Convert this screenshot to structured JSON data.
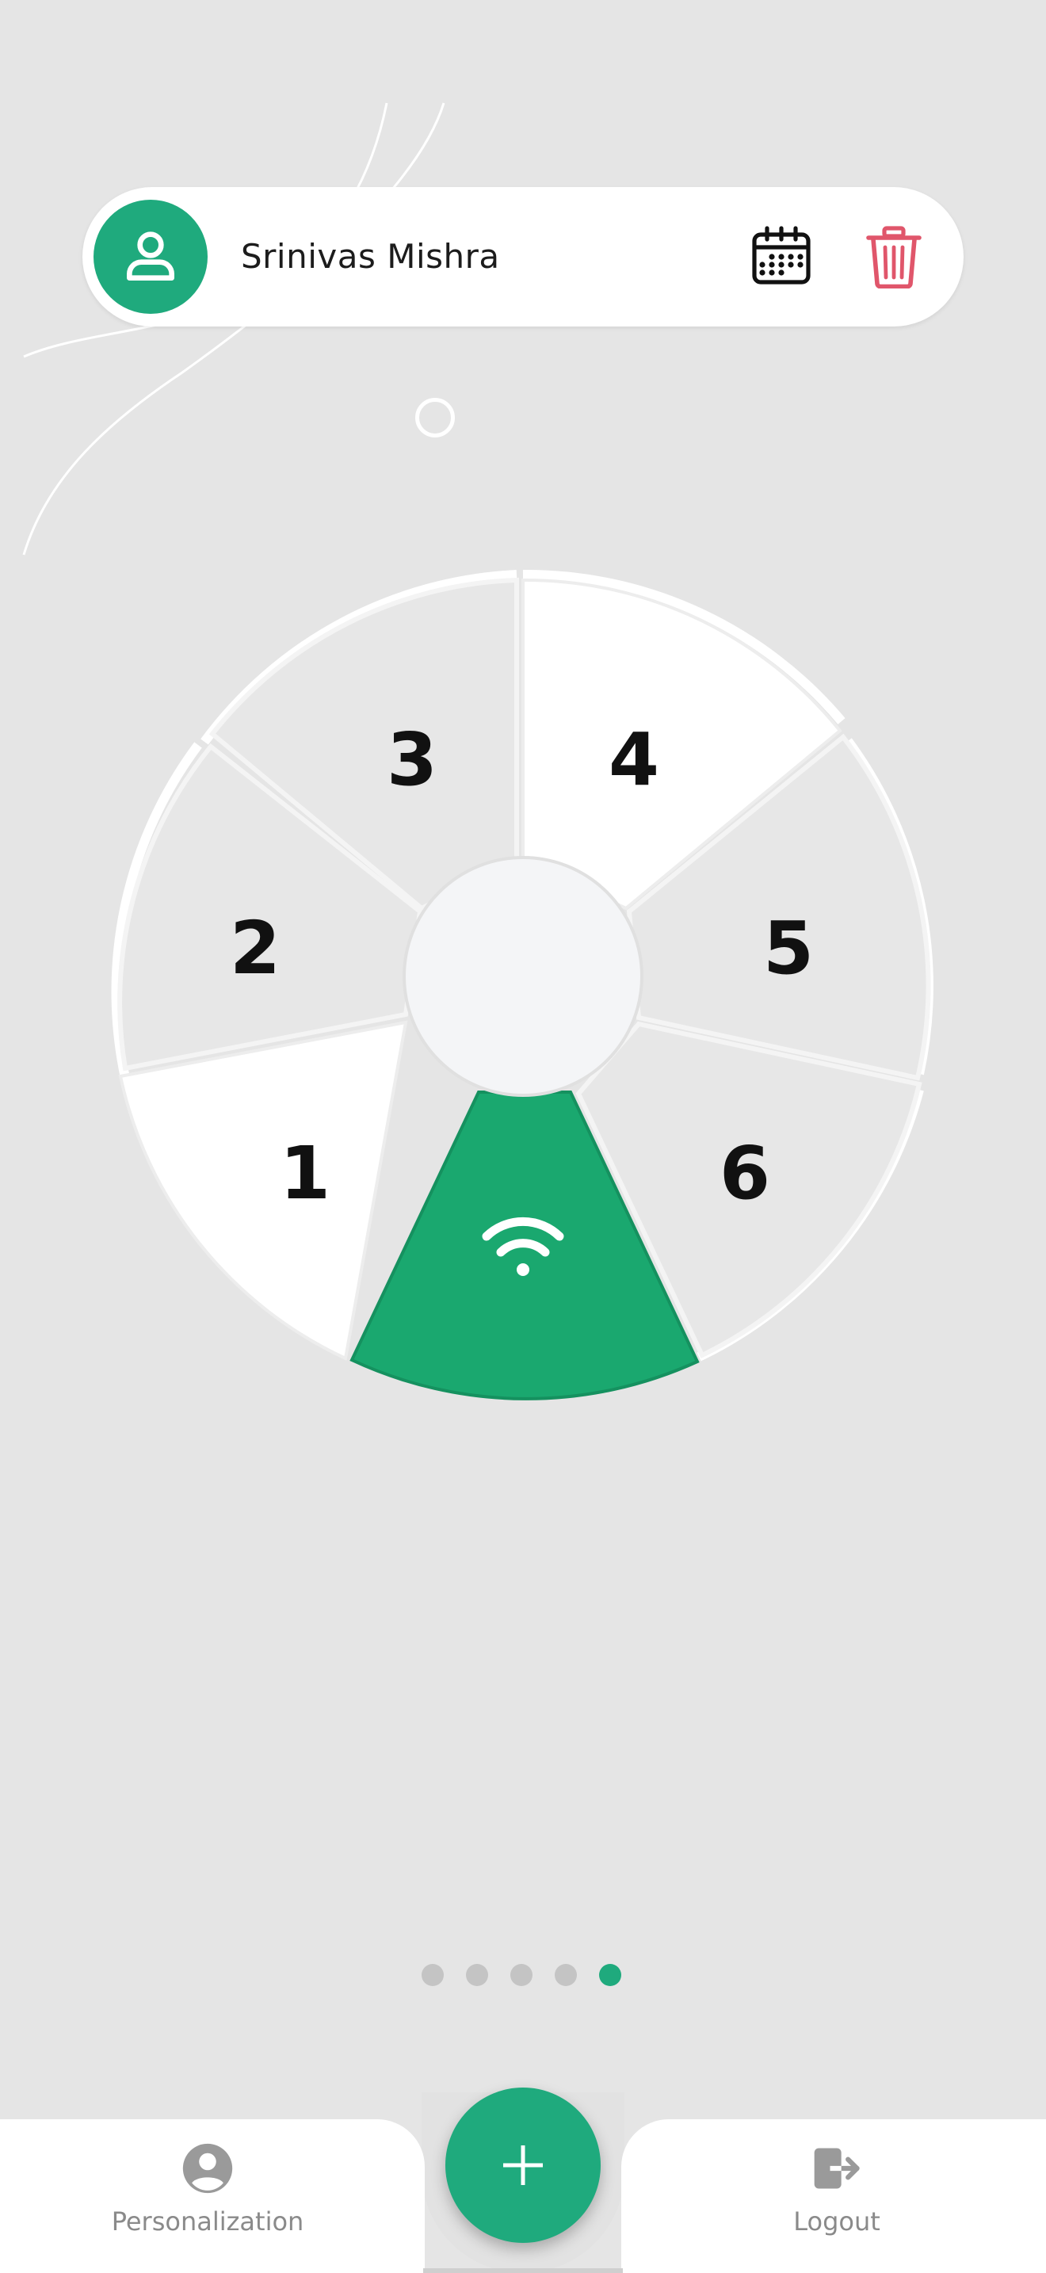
{
  "user": {
    "name": "Srinivas Mishra",
    "avatar_icon": "person-icon"
  },
  "header_actions": {
    "calendar_icon": "calendar-icon",
    "delete_icon": "trash-icon"
  },
  "wheel": {
    "segments": [
      {
        "label": "1"
      },
      {
        "label": "2"
      },
      {
        "label": "3"
      },
      {
        "label": "4"
      },
      {
        "label": "5"
      },
      {
        "label": "6"
      }
    ],
    "active_segment_icon": "wifi-icon"
  },
  "pager": {
    "count": 5,
    "active_index": 4
  },
  "bottom_nav": {
    "left_label": "Personalization",
    "right_label": "Logout",
    "fab_icon": "plus-icon"
  },
  "colors": {
    "accent": "#1faa7d",
    "delete": "#e0566b",
    "background": "#e5e5e5"
  }
}
